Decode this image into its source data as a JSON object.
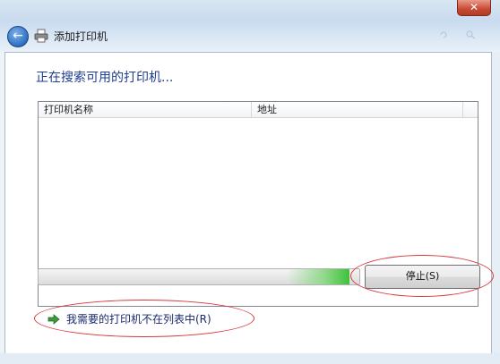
{
  "window": {
    "title": "添加打印机",
    "close_label": "✕"
  },
  "main": {
    "heading": "正在搜索可用的打印机..."
  },
  "printer_list": {
    "columns": [
      "打印机名称",
      "地址"
    ],
    "rows": []
  },
  "search": {
    "progress_fraction": 0.97
  },
  "actions": {
    "stop_label": "停止(S)",
    "not_listed_label": "我需要的打印机不在列表中(R)"
  },
  "colors": {
    "heading": "#1e3e8f",
    "annotation": "#d9383a",
    "progress": "#3ec13a"
  }
}
